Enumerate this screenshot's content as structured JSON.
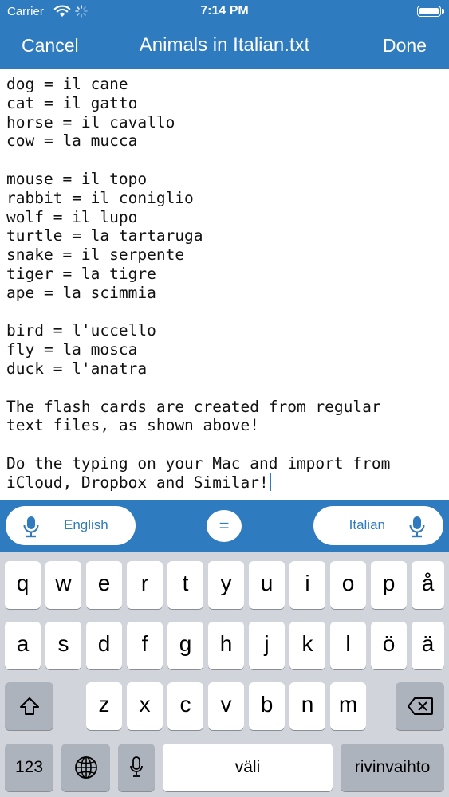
{
  "status": {
    "carrier": "Carrier",
    "time": "7:14 PM"
  },
  "nav": {
    "cancel": "Cancel",
    "title": "Animals in Italian.txt",
    "done": "Done"
  },
  "editor": {
    "lines": [
      "dog = il cane",
      "cat = il gatto",
      "horse = il cavallo",
      "cow = la mucca",
      "",
      "mouse = il topo",
      "rabbit = il coniglio",
      "wolf = il lupo",
      "turtle = la tartaruga",
      "snake = il serpente",
      "tiger = la tigre",
      "ape = la scimmia",
      "",
      "bird = l'uccello",
      "fly = la mosca",
      "duck = l'anatra",
      "",
      "The flash cards are created from regular",
      "text files, as shown above!",
      "",
      "Do the typing on your Mac and import from",
      "iCloud, Dropbox and Similar!"
    ]
  },
  "langbar": {
    "left_language": "English",
    "separator": "=",
    "right_language": "Italian"
  },
  "keyboard": {
    "row1": [
      "q",
      "w",
      "e",
      "r",
      "t",
      "y",
      "u",
      "i",
      "o",
      "p",
      "å"
    ],
    "row2": [
      "a",
      "s",
      "d",
      "f",
      "g",
      "h",
      "j",
      "k",
      "l",
      "ö",
      "ä"
    ],
    "row3": [
      "z",
      "x",
      "c",
      "v",
      "b",
      "n",
      "m"
    ],
    "numbers_key": "123",
    "space_label": "väli",
    "return_label": "rivinvaihto"
  },
  "colors": {
    "accent": "#2f7bbf",
    "keyboard_bg": "#d1d5db",
    "dark_key": "#acb3bd"
  }
}
